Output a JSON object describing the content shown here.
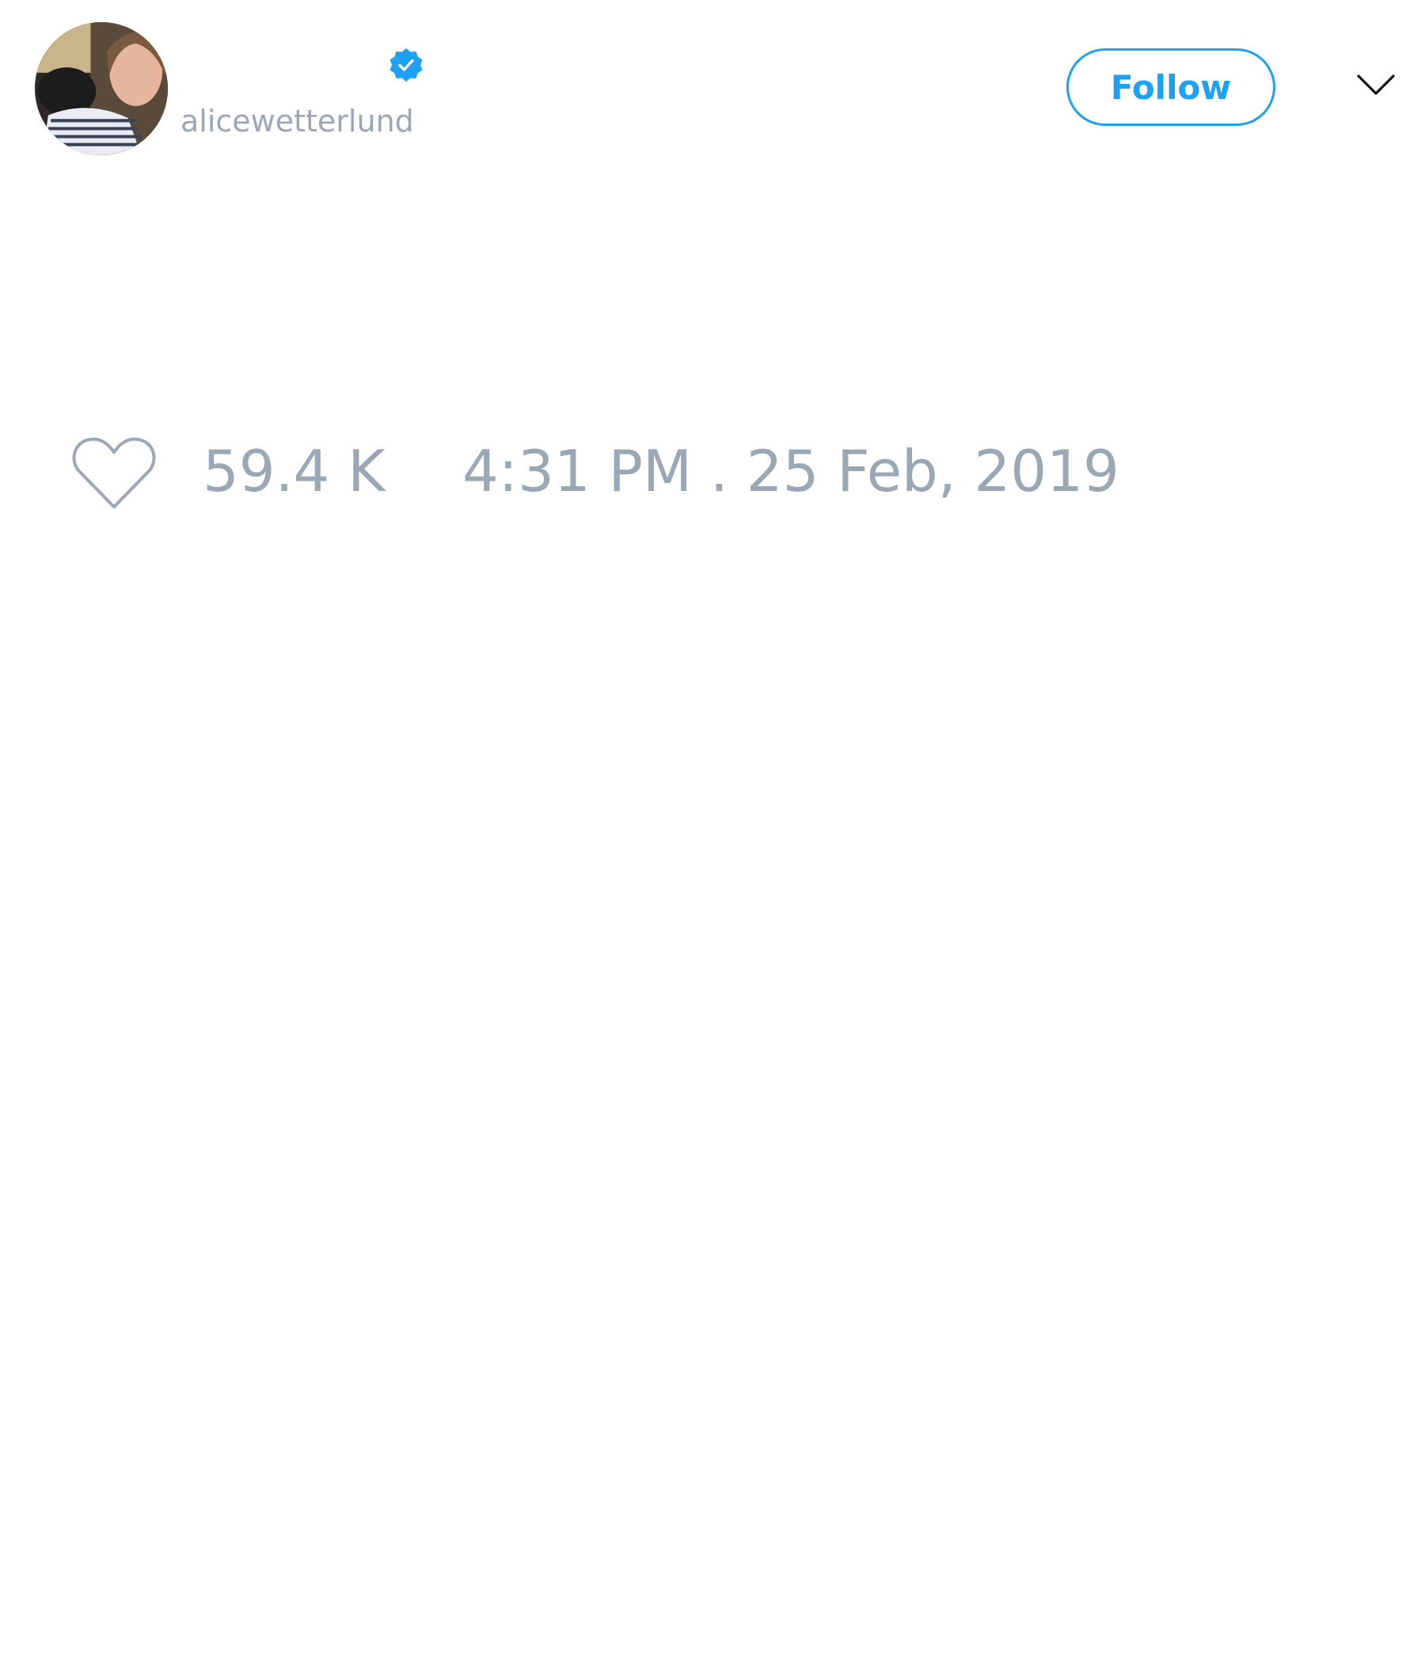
{
  "tweet": {
    "author": {
      "avatar_icon": "profile-photo",
      "verified": true,
      "verified_icon": "verified-badge-icon",
      "username": "alicewetterlund"
    },
    "follow_label": "Follow",
    "more_icon": "chevron-down-icon",
    "like_icon": "heart-outline-icon",
    "like_count": "59.4 K",
    "timestamp": "4:31 PM . 25 Feb, 2019"
  },
  "colors": {
    "accent": "#1da1f2",
    "muted_text": "#9aa7b5",
    "background": "#ffffff"
  }
}
